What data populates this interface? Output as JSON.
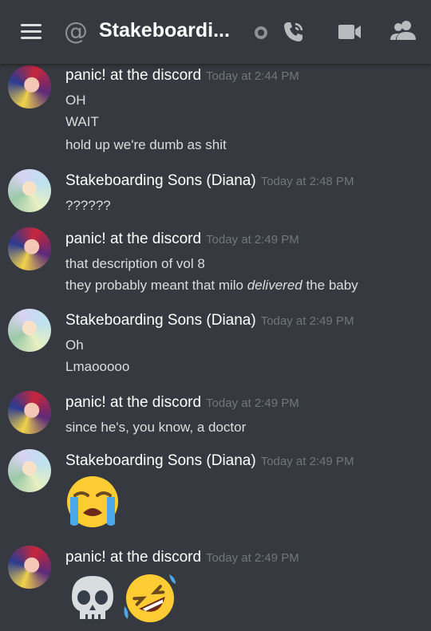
{
  "header": {
    "title": "Stakeboardi...",
    "icons": [
      "menu-icon",
      "at-icon",
      "status-icon",
      "call-icon",
      "video-icon",
      "members-icon"
    ]
  },
  "messages": [
    {
      "author": "panic! at the discord",
      "time": "Today at 2:44 PM",
      "lines": [
        "OH",
        "WAIT",
        "hold up we're dumb as shit"
      ]
    },
    {
      "author": "Stakeboarding Sons (Diana)",
      "time": "Today at 2:48 PM",
      "lines": [
        "??????"
      ]
    },
    {
      "author": "panic! at the discord",
      "time": "Today at 2:49 PM",
      "lines": [
        "that description of vol 8"
      ],
      "rich_line": {
        "before": "they probably meant that milo ",
        "italic": "delivered",
        "after": " the baby"
      }
    },
    {
      "author": "Stakeboarding Sons (Diana)",
      "time": "Today at 2:49 PM",
      "lines": [
        "Oh",
        "Lmaooooo"
      ]
    },
    {
      "author": "panic! at the discord",
      "time": "Today at 2:49 PM",
      "lines": [
        "since he's, you know, a doctor"
      ]
    },
    {
      "author": "Stakeboarding Sons (Diana)",
      "time": "Today at 2:49 PM",
      "emojis": [
        "loudly-crying-face-emoji"
      ]
    },
    {
      "author": "panic! at the discord",
      "time": "Today at 2:49 PM",
      "emojis": [
        "skull-emoji",
        "rolling-on-floor-laughing-emoji"
      ]
    }
  ],
  "colors": {
    "background": "#36393f",
    "author": "#ffffff",
    "timestamp": "#72767d",
    "text": "#dcddde",
    "icon": "#b9bbbe"
  }
}
